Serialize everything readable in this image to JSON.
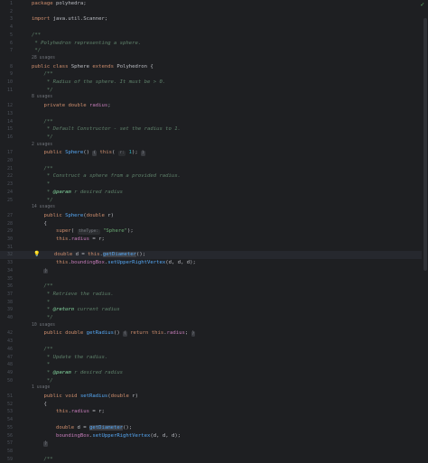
{
  "editor": {
    "language": "Java",
    "inspection_icon": "checkmark-icon",
    "bulb_icon": "lightbulb-icon",
    "lines": [
      {
        "n": "1",
        "code": "package polyhedra;"
      },
      {
        "n": "2",
        "code": ""
      },
      {
        "n": "3",
        "code": "import java.util.Scanner;"
      },
      {
        "n": "4",
        "code": ""
      },
      {
        "n": "5",
        "code": "/**"
      },
      {
        "n": "6",
        "code": " * Polyhedron representing a sphere."
      },
      {
        "n": "7",
        "code": " */"
      },
      {
        "usages": "28 usages"
      },
      {
        "n": "8",
        "code": "public class Sphere extends Polyhedron {"
      },
      {
        "n": "9",
        "code": "    /**"
      },
      {
        "n": "10",
        "code": "     * Radius of the sphere. It must be > 0."
      },
      {
        "n": "11",
        "code": "     */"
      },
      {
        "usages": "8 usages"
      },
      {
        "n": "12",
        "code": "    private double radius;"
      },
      {
        "n": "13",
        "code": ""
      },
      {
        "n": "14",
        "code": "    /**"
      },
      {
        "n": "15",
        "code": "     * Default Constructor - set the radius to 1."
      },
      {
        "n": "16",
        "code": "     */"
      },
      {
        "usages": "2 usages"
      },
      {
        "n": "17",
        "code": "    public Sphere() { this( r: 1); }"
      },
      {
        "n": "20",
        "code": ""
      },
      {
        "n": "21",
        "code": "    /**"
      },
      {
        "n": "22",
        "code": "     * Construct a sphere from a provided radius."
      },
      {
        "n": "23",
        "code": "     *"
      },
      {
        "n": "24",
        "code": "     * @param r desired radius"
      },
      {
        "n": "25",
        "code": "     */"
      },
      {
        "usages": "14 usages"
      },
      {
        "n": "27",
        "code": "    public Sphere(double r)"
      },
      {
        "n": "28",
        "code": "    {"
      },
      {
        "n": "29",
        "code": "        super( theType: \"Sphere\");"
      },
      {
        "n": "30",
        "code": "        this.radius = r;"
      },
      {
        "n": "31",
        "code": ""
      },
      {
        "n": "32",
        "code": "        double d = this.getDiameter();"
      },
      {
        "n": "33",
        "code": "        this.boundingBox.setUpperRightVertex(d, d, d);"
      },
      {
        "n": "34",
        "code": "    }"
      },
      {
        "n": "35",
        "code": ""
      },
      {
        "n": "36",
        "code": "    /**"
      },
      {
        "n": "37",
        "code": "     * Retrieve the radius."
      },
      {
        "n": "38",
        "code": "     *"
      },
      {
        "n": "39",
        "code": "     * @return current radius"
      },
      {
        "n": "40",
        "code": "     */"
      },
      {
        "usages": "10 usages"
      },
      {
        "n": "42",
        "code": "    public double getRadius() { return this.radius; }"
      },
      {
        "n": "43",
        "code": ""
      },
      {
        "n": "46",
        "code": "    /**"
      },
      {
        "n": "47",
        "code": "     * Update the radius."
      },
      {
        "n": "48",
        "code": "     *"
      },
      {
        "n": "49",
        "code": "     * @param r desired radius"
      },
      {
        "n": "50",
        "code": "     */"
      },
      {
        "usages": "1 usage"
      },
      {
        "n": "51",
        "code": "    public void setRadius(double r)"
      },
      {
        "n": "52",
        "code": "    {"
      },
      {
        "n": "53",
        "code": "        this.radius = r;"
      },
      {
        "n": "54",
        "code": ""
      },
      {
        "n": "55",
        "code": "        double d = getDiameter();"
      },
      {
        "n": "56",
        "code": "        boundingBox.setUpperRightVertex(d, d, d);"
      },
      {
        "n": "57",
        "code": "    }"
      },
      {
        "n": "58",
        "code": ""
      },
      {
        "n": "59",
        "code": "    /**"
      }
    ]
  }
}
